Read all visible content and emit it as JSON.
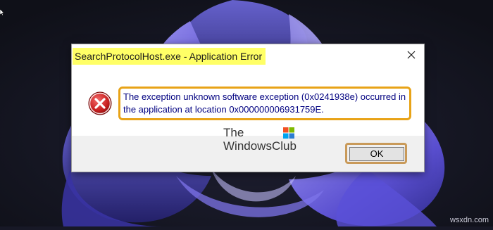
{
  "desktop": {
    "wallpaper": "windows-11-bloom",
    "accent_colors": [
      "#3d3d9e",
      "#6b5fd8",
      "#8f86e8",
      "#17172a"
    ]
  },
  "dialog": {
    "title": "SearchProtocolHost.exe - Application Error",
    "message": "The exception unknown software exception (0x0241938e) occurred in the application at location 0x000000006931759E.",
    "icon": "error-icon",
    "ok_label": "OK",
    "close_icon": "close-icon",
    "highlight_color": "#ffff66",
    "annotation_color": "#e8a317"
  },
  "watermark": {
    "line1": "The",
    "line2": "WindowsClub",
    "logo": "windowsclub-logo"
  },
  "site_watermark": "wsxdn.com"
}
